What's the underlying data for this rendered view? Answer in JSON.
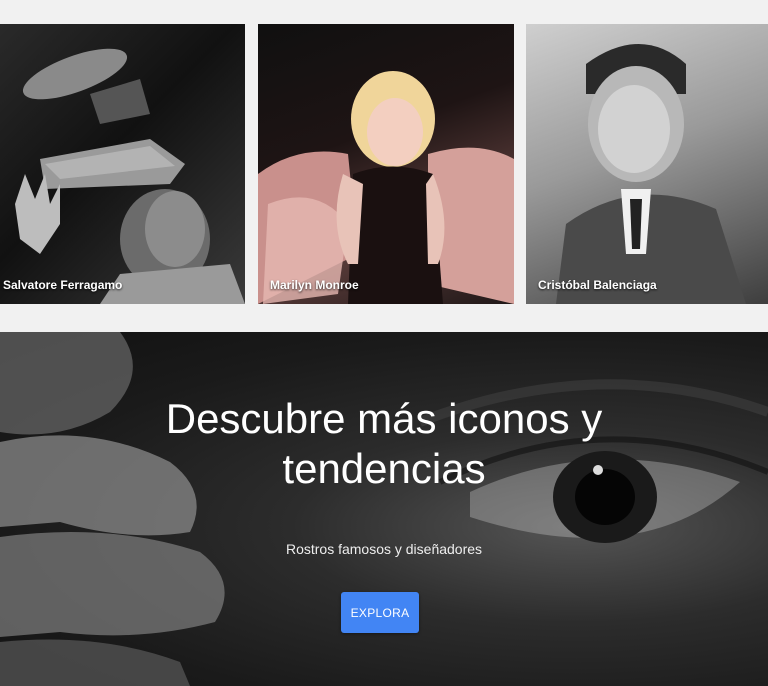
{
  "cards": [
    {
      "label": "Salvatore Ferragamo"
    },
    {
      "label": "Marilyn Monroe"
    },
    {
      "label": "Cristóbal Balenciaga"
    }
  ],
  "hero": {
    "title_line1": "Descubre más iconos y",
    "title_line2": "tendencias",
    "subtitle": "Rostros famosos y diseñadores",
    "button_label": "EXPLORA"
  },
  "colors": {
    "page_background": "#f1f1f1",
    "button_background": "#4285f4",
    "text_light": "#ffffff"
  }
}
